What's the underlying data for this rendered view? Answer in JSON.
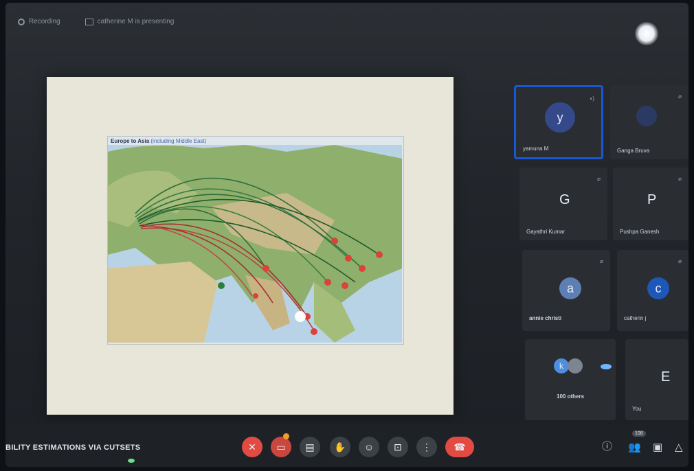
{
  "topbar": {
    "recording_label": "Recording",
    "presenting_label": "catherine M is presenting"
  },
  "slide": {
    "map_title": "Europe to Asia",
    "map_subtitle": "(including Middle East)"
  },
  "participants": [
    {
      "name": "yamuna M",
      "initial": "y",
      "avatar_color": "#3a4f8c",
      "speaking": true
    },
    {
      "name": "Ganga Bruva",
      "initial": "",
      "avatar_color": "#2a3a63"
    },
    {
      "name": "Gayathri Kumar",
      "initial": "G"
    },
    {
      "name": "Pushpa Ganesh",
      "initial": "P"
    },
    {
      "name": "annie christi",
      "initial": "a",
      "avatar_color": "#5d7fb3"
    },
    {
      "name": "catherin j",
      "initial": "c",
      "avatar_color": "#1f57b8"
    },
    {
      "name": "100 others",
      "initial": "k",
      "avatar_color": "#4e8de0"
    },
    {
      "name": "You",
      "initial": "E"
    }
  ],
  "bottombar": {
    "meeting_title": "BILITY ESTIMATIONS VIA CUTSETS",
    "participant_count": "108"
  },
  "colors": {
    "accent": "#1a57d6",
    "danger": "#e24b42"
  },
  "icons": {
    "mic_off": "mic-off-icon",
    "camera_off": "camera-off-icon",
    "captions": "captions-icon",
    "hand": "raise-hand-icon",
    "emoji": "emoji-icon",
    "present": "present-icon",
    "more": "more-options-icon",
    "hangup": "hang-up-icon",
    "info": "info-icon",
    "people": "people-icon",
    "chat": "chat-icon",
    "activities": "activities-icon"
  }
}
